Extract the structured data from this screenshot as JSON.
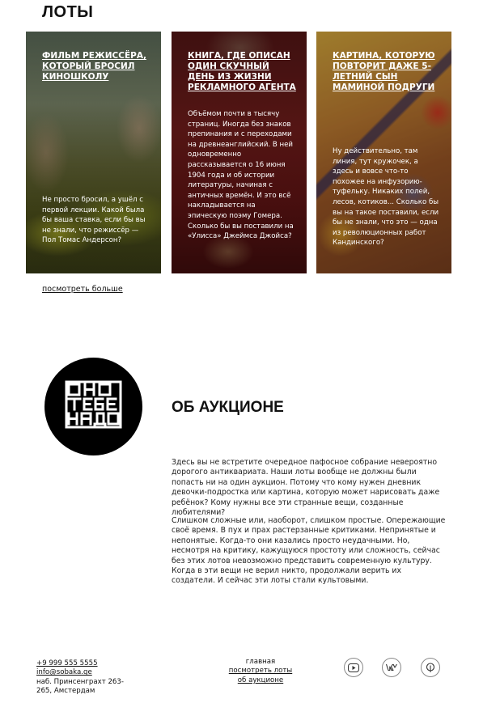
{
  "lots_section": {
    "title": "ЛОТЫ",
    "cards": [
      {
        "title": "Фильм режиссёра, который бросил киношколу",
        "description": "Не просто бросил, а ушёл с первой лекции. Какой была бы ваша ставка, если бы вы не знали, что режиссёр — Пол Томас Андерсон?"
      },
      {
        "title": "Книга, где описан один скучный день из жизни рекламного агента",
        "description": "Объёмом почти в тысячу страниц. Иногда без знаков препинания и с переходами на древнеанглийский. В ней одновременно рассказывается о 16 июня 1904 года и об истории литературы, начиная с античных времён. И это всё накладывается на эпическую поэму Гомера. Сколько бы вы поставили на «Улисса» Джеймса Джойса?"
      },
      {
        "title": "Картина, которую повторит даже 5-летний сын маминой подруги",
        "description": "Ну действительно, там линия, тут кружочек, а здесь и вовсе что-то похожее на инфузорию-туфельку. Никаких полей, лесов, котиков... Сколько бы вы на такое поставили, если бы не знали, что это — одна из революционных работ Кандинского?"
      }
    ],
    "see_more_label": "посмотреть больше"
  },
  "logo": {
    "alt_text": "ОНО ТЕБЕ НАДО"
  },
  "about": {
    "title": "ОБ АУКЦИОНЕ",
    "paragraphs": [
      "Здесь вы не встретите очередное пафосное собрание невероятно дорогого антиквариата. Наши лоты вообще не должны были попасть ни на один аукцион. Потому что кому нужен дневник девочки-подростка или картина, которую может нарисовать даже ребёнок? Кому нужны все эти странные вещи, созданные любителями?",
      "Слишком сложные или, наоборот, слишком простые. Опережающие своё время. В пух и прах растерзанные критиками. Непринятые и непонятые. Когда-то они казались просто неудачными. Но, несмотря на критику, кажущуюся простоту или сложность, сейчас без этих лотов невозможно представить современную культуру. Когда в эти вещи не верил никто, продолжали верить их создатели. И сейчас эти лоты стали культовыми."
    ]
  },
  "footer": {
    "phone": "+9 999 555 5555",
    "email": "info@sobaka.ge",
    "address": "наб. Принсенграхт 263-265, Амстердам",
    "nav": {
      "home": "главная",
      "lots": "посмотреть лоты",
      "about": "об аукционе"
    },
    "social_icons": [
      "youtube-icon",
      "vk-icon",
      "pinterest-icon"
    ]
  },
  "colors": {
    "text": "#111111",
    "background": "#ffffff",
    "logo_bg": "#000000"
  }
}
